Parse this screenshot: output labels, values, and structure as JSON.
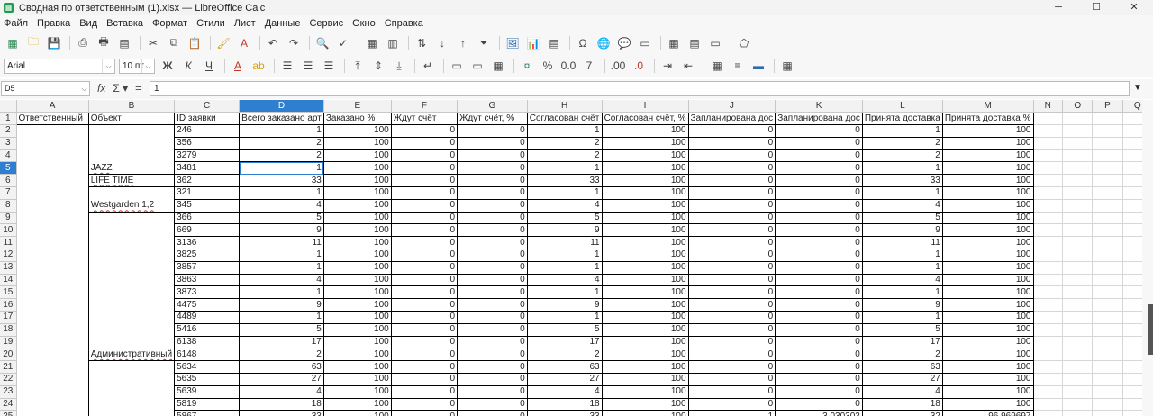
{
  "window": {
    "title": "Сводная по ответственным (1).xlsx — LibreOffice Calc",
    "app_icon": "spreadsheet-icon"
  },
  "menu": [
    "Файл",
    "Правка",
    "Вид",
    "Вставка",
    "Формат",
    "Стили",
    "Лист",
    "Данные",
    "Сервис",
    "Окно",
    "Справка"
  ],
  "font": {
    "name": "Arial",
    "size": "10 пт"
  },
  "formula_bar": {
    "cell_ref": "D5",
    "content": "1"
  },
  "columns": [
    "A",
    "B",
    "C",
    "D",
    "E",
    "F",
    "G",
    "H",
    "I",
    "J",
    "K",
    "L",
    "M",
    "N",
    "O",
    "P",
    "Q"
  ],
  "selected_column": "D",
  "selected_row": "5",
  "headers": [
    "Ответственный",
    "Объект",
    "ID заявки",
    "Всего заказано арт",
    "Заказано %",
    "Ждут счёт",
    "Ждут счёт, %",
    "Согласован счёт",
    "Согласован счёт, %",
    "Запланирована дос",
    "Запланирована дос",
    "Принята доставка",
    "Принята доставка %"
  ],
  "rows": [
    {
      "n": "2",
      "a": "",
      "b": "",
      "c": "246",
      "d": "1",
      "e": "100",
      "f": "0",
      "g": "0",
      "h": "1",
      "i": "100",
      "j": "0",
      "k": "0",
      "l": "1",
      "m": "100"
    },
    {
      "n": "3",
      "a": "",
      "b": "",
      "c": "356",
      "d": "2",
      "e": "100",
      "f": "0",
      "g": "0",
      "h": "2",
      "i": "100",
      "j": "0",
      "k": "0",
      "l": "2",
      "m": "100"
    },
    {
      "n": "4",
      "a": "",
      "b": "",
      "c": "3279",
      "d": "2",
      "e": "100",
      "f": "0",
      "g": "0",
      "h": "2",
      "i": "100",
      "j": "0",
      "k": "0",
      "l": "2",
      "m": "100"
    },
    {
      "n": "5",
      "a": "",
      "b": "JAZZ",
      "c": "3481",
      "d": "1",
      "e": "100",
      "f": "0",
      "g": "0",
      "h": "1",
      "i": "100",
      "j": "0",
      "k": "0",
      "l": "1",
      "m": "100"
    },
    {
      "n": "6",
      "a": "",
      "b": "LIFE TIME",
      "c": "362",
      "d": "33",
      "e": "100",
      "f": "0",
      "g": "0",
      "h": "33",
      "i": "100",
      "j": "0",
      "k": "0",
      "l": "33",
      "m": "100"
    },
    {
      "n": "7",
      "a": "",
      "b": "",
      "c": "321",
      "d": "1",
      "e": "100",
      "f": "0",
      "g": "0",
      "h": "1",
      "i": "100",
      "j": "0",
      "k": "0",
      "l": "1",
      "m": "100"
    },
    {
      "n": "8",
      "a": "",
      "b": "Westgarden 1,2",
      "c": "345",
      "d": "4",
      "e": "100",
      "f": "0",
      "g": "0",
      "h": "4",
      "i": "100",
      "j": "0",
      "k": "0",
      "l": "4",
      "m": "100"
    },
    {
      "n": "9",
      "a": "",
      "b": "",
      "c": "366",
      "d": "5",
      "e": "100",
      "f": "0",
      "g": "0",
      "h": "5",
      "i": "100",
      "j": "0",
      "k": "0",
      "l": "5",
      "m": "100"
    },
    {
      "n": "10",
      "a": "",
      "b": "",
      "c": "669",
      "d": "9",
      "e": "100",
      "f": "0",
      "g": "0",
      "h": "9",
      "i": "100",
      "j": "0",
      "k": "0",
      "l": "9",
      "m": "100"
    },
    {
      "n": "11",
      "a": "",
      "b": "",
      "c": "3136",
      "d": "11",
      "e": "100",
      "f": "0",
      "g": "0",
      "h": "11",
      "i": "100",
      "j": "0",
      "k": "0",
      "l": "11",
      "m": "100"
    },
    {
      "n": "12",
      "a": "",
      "b": "",
      "c": "3825",
      "d": "1",
      "e": "100",
      "f": "0",
      "g": "0",
      "h": "1",
      "i": "100",
      "j": "0",
      "k": "0",
      "l": "1",
      "m": "100"
    },
    {
      "n": "13",
      "a": "",
      "b": "",
      "c": "3857",
      "d": "1",
      "e": "100",
      "f": "0",
      "g": "0",
      "h": "1",
      "i": "100",
      "j": "0",
      "k": "0",
      "l": "1",
      "m": "100"
    },
    {
      "n": "14",
      "a": "",
      "b": "",
      "c": "3863",
      "d": "4",
      "e": "100",
      "f": "0",
      "g": "0",
      "h": "4",
      "i": "100",
      "j": "0",
      "k": "0",
      "l": "4",
      "m": "100"
    },
    {
      "n": "15",
      "a": "",
      "b": "",
      "c": "3873",
      "d": "1",
      "e": "100",
      "f": "0",
      "g": "0",
      "h": "1",
      "i": "100",
      "j": "0",
      "k": "0",
      "l": "1",
      "m": "100"
    },
    {
      "n": "16",
      "a": "",
      "b": "",
      "c": "4475",
      "d": "9",
      "e": "100",
      "f": "0",
      "g": "0",
      "h": "9",
      "i": "100",
      "j": "0",
      "k": "0",
      "l": "9",
      "m": "100"
    },
    {
      "n": "17",
      "a": "",
      "b": "",
      "c": "4489",
      "d": "1",
      "e": "100",
      "f": "0",
      "g": "0",
      "h": "1",
      "i": "100",
      "j": "0",
      "k": "0",
      "l": "1",
      "m": "100"
    },
    {
      "n": "18",
      "a": "",
      "b": "",
      "c": "5416",
      "d": "5",
      "e": "100",
      "f": "0",
      "g": "0",
      "h": "5",
      "i": "100",
      "j": "0",
      "k": "0",
      "l": "5",
      "m": "100"
    },
    {
      "n": "19",
      "a": "",
      "b": "",
      "c": "6138",
      "d": "17",
      "e": "100",
      "f": "0",
      "g": "0",
      "h": "17",
      "i": "100",
      "j": "0",
      "k": "0",
      "l": "17",
      "m": "100"
    },
    {
      "n": "20",
      "a": "",
      "b": "Административный",
      "c": "6148",
      "d": "2",
      "e": "100",
      "f": "0",
      "g": "0",
      "h": "2",
      "i": "100",
      "j": "0",
      "k": "0",
      "l": "2",
      "m": "100"
    },
    {
      "n": "21",
      "a": "",
      "b": "",
      "c": "5634",
      "d": "63",
      "e": "100",
      "f": "0",
      "g": "0",
      "h": "63",
      "i": "100",
      "j": "0",
      "k": "0",
      "l": "63",
      "m": "100"
    },
    {
      "n": "22",
      "a": "",
      "b": "",
      "c": "5635",
      "d": "27",
      "e": "100",
      "f": "0",
      "g": "0",
      "h": "27",
      "i": "100",
      "j": "0",
      "k": "0",
      "l": "27",
      "m": "100"
    },
    {
      "n": "23",
      "a": "",
      "b": "",
      "c": "5639",
      "d": "4",
      "e": "100",
      "f": "0",
      "g": "0",
      "h": "4",
      "i": "100",
      "j": "0",
      "k": "0",
      "l": "4",
      "m": "100"
    },
    {
      "n": "24",
      "a": "",
      "b": "",
      "c": "5819",
      "d": "18",
      "e": "100",
      "f": "0",
      "g": "0",
      "h": "18",
      "i": "100",
      "j": "0",
      "k": "0",
      "l": "18",
      "m": "100"
    },
    {
      "n": "25",
      "a": "",
      "b": "",
      "c": "5867",
      "d": "33",
      "e": "100",
      "f": "0",
      "g": "0",
      "h": "33",
      "i": "100",
      "j": "1",
      "k": "3,030303",
      "l": "32",
      "m": "96,969697"
    }
  ],
  "colors": {
    "selection": "#2f7fd1",
    "header_bg": "#f2f2f2",
    "app_green": "#1f9b4a"
  }
}
